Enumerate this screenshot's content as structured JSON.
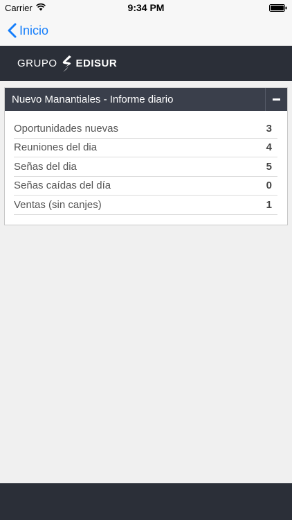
{
  "status_bar": {
    "carrier": "Carrier",
    "time": "9:34 PM"
  },
  "nav": {
    "back_label": "Inicio"
  },
  "brand": {
    "part_a": "GRUPO",
    "part_b": "EDISUR"
  },
  "panel": {
    "title": "Nuevo Manantiales - Informe diario",
    "rows": [
      {
        "label": "Oportunidades nuevas",
        "value": "3"
      },
      {
        "label": "Reuniones del dia",
        "value": "4"
      },
      {
        "label": "Señas del dia",
        "value": "5"
      },
      {
        "label": "Señas caídas del día",
        "value": "0"
      },
      {
        "label": "Ventas (sin canjes)",
        "value": "1"
      }
    ]
  },
  "colors": {
    "accent": "#157efb",
    "header_dark": "#2b2f38",
    "panel_header": "#3a3f4b",
    "background": "#f0f0f0"
  }
}
